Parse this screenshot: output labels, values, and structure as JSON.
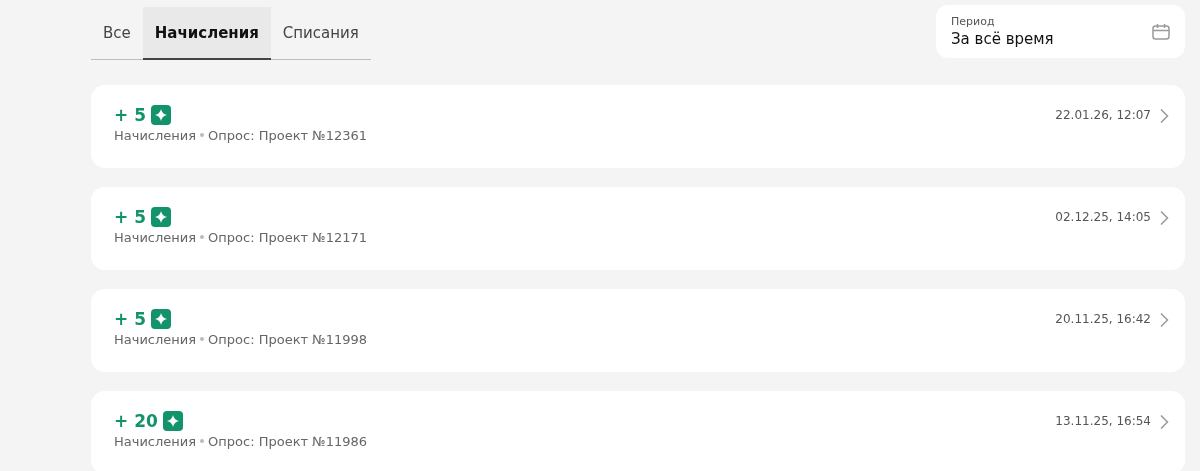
{
  "tabs": [
    {
      "label": "Все",
      "selected": false
    },
    {
      "label": "Начисления",
      "selected": true
    },
    {
      "label": "Списания",
      "selected": false
    }
  ],
  "period": {
    "label": "Период",
    "value": "За всё время"
  },
  "transactions": [
    {
      "amount": "+ 5",
      "category": "Начисления",
      "source": "Опрос: Проект №12361",
      "date": "22.01.26, 12:07"
    },
    {
      "amount": "+ 5",
      "category": "Начисления",
      "source": "Опрос: Проект №12171",
      "date": "02.12.25, 14:05"
    },
    {
      "amount": "+ 5",
      "category": "Начисления",
      "source": "Опрос: Проект №11998",
      "date": "20.11.25, 16:42"
    },
    {
      "amount": "+ 20",
      "category": "Начисления",
      "source": "Опрос: Проект №11986",
      "date": "13.11.25, 16:54"
    }
  ]
}
